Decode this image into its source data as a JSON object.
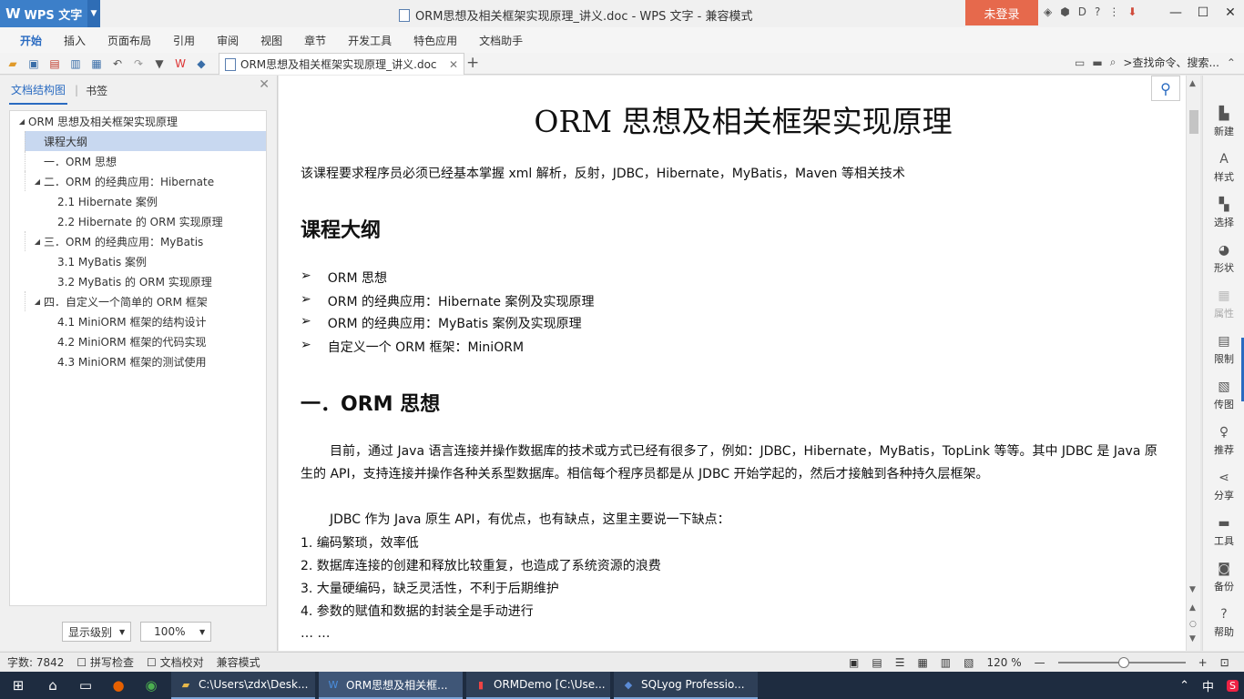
{
  "titlebar": {
    "app_name": "WPS 文字",
    "title": "ORM思想及相关框架实现原理_讲义.doc - WPS 文字 - 兼容模式",
    "login": "未登录"
  },
  "ribbon": {
    "tabs": [
      "开始",
      "插入",
      "页面布局",
      "引用",
      "审阅",
      "视图",
      "章节",
      "开发工具",
      "特色应用",
      "文档助手"
    ]
  },
  "toolbar": {
    "doc_tab": "ORM思想及相关框架实现原理_讲义.doc",
    "search": ">查找命令、搜索..."
  },
  "leftpanel": {
    "tab_outline": "文档结构图",
    "tab_bookmark": "书签",
    "outline": [
      {
        "label": "ORM 思想及相关框架实现原理",
        "level": 1,
        "expandable": true,
        "selected": false
      },
      {
        "label": "课程大纲",
        "level": 2,
        "expandable": false,
        "selected": true
      },
      {
        "label": "一．ORM 思想",
        "level": 2,
        "expandable": false,
        "selected": false
      },
      {
        "label": "二．ORM 的经典应用：Hibernate",
        "level": 2,
        "expandable": true,
        "selected": false
      },
      {
        "label": "2.1 Hibernate 案例",
        "level": 3,
        "expandable": false,
        "selected": false
      },
      {
        "label": "2.2 Hibernate 的 ORM 实现原理",
        "level": 3,
        "expandable": false,
        "selected": false
      },
      {
        "label": "三．ORM 的经典应用：MyBatis",
        "level": 2,
        "expandable": true,
        "selected": false
      },
      {
        "label": "3.1 MyBatis 案例",
        "level": 3,
        "expandable": false,
        "selected": false
      },
      {
        "label": "3.2 MyBatis 的 ORM 实现原理",
        "level": 3,
        "expandable": false,
        "selected": false
      },
      {
        "label": "四．自定义一个简单的 ORM 框架",
        "level": 2,
        "expandable": true,
        "selected": false
      },
      {
        "label": "4.1 MiniORM 框架的结构设计",
        "level": 3,
        "expandable": false,
        "selected": false
      },
      {
        "label": "4.2 MiniORM 框架的代码实现",
        "level": 3,
        "expandable": false,
        "selected": false
      },
      {
        "label": "4.3 MiniORM 框架的测试使用",
        "level": 3,
        "expandable": false,
        "selected": false
      }
    ],
    "level_select": "显示级别",
    "zoom_select": "100%"
  },
  "document": {
    "title": "ORM 思想及相关框架实现原理",
    "intro": "该课程要求程序员必须已经基本掌握 xml 解析，反射，JDBC，Hibernate，MyBatis，Maven 等相关技术",
    "outline_heading": "课程大纲",
    "bullets": [
      "ORM 思想",
      "ORM 的经典应用：Hibernate 案例及实现原理",
      "ORM 的经典应用：MyBatis 案例及实现原理",
      "自定义一个 ORM 框架：MiniORM"
    ],
    "section1_heading": "一．ORM 思想",
    "para1": "目前，通过 Java 语言连接并操作数据库的技术或方式已经有很多了，例如：JDBC，Hibernate，MyBatis，TopLink 等等。其中 JDBC 是 Java 原生的 API，支持连接并操作各种关系型数据库。相信每个程序员都是从 JDBC 开始学起的，然后才接触到各种持久层框架。",
    "para2": "JDBC 作为 Java 原生 API，有优点，也有缺点，这里主要说一下缺点：",
    "list": [
      "1. 编码繁琐，效率低",
      "2. 数据库连接的创建和释放比较重复，也造成了系统资源的浪费",
      "3. 大量硬编码，缺乏灵活性，不利于后期维护",
      "4. 参数的赋值和数据的封装全是手动进行"
    ],
    "ellipsis": "… …"
  },
  "rightbar": {
    "items": [
      {
        "label": "新建",
        "icon": "new-icon",
        "dim": false
      },
      {
        "label": "样式",
        "icon": "style-icon",
        "dim": false
      },
      {
        "label": "选择",
        "icon": "select-icon",
        "dim": false
      },
      {
        "label": "形状",
        "icon": "shape-icon",
        "dim": false
      },
      {
        "label": "属性",
        "icon": "property-icon",
        "dim": true
      },
      {
        "label": "限制",
        "icon": "restrict-icon",
        "dim": false
      },
      {
        "label": "传图",
        "icon": "upload-image-icon",
        "dim": false
      },
      {
        "label": "推荐",
        "icon": "recommend-icon",
        "dim": false
      },
      {
        "label": "分享",
        "icon": "share-icon",
        "dim": false
      },
      {
        "label": "工具",
        "icon": "tools-icon",
        "dim": false
      },
      {
        "label": "备份",
        "icon": "backup-icon",
        "dim": false
      },
      {
        "label": "帮助",
        "icon": "help-icon",
        "dim": false
      }
    ]
  },
  "statusbar": {
    "word_count": "字数: 7842",
    "spell_check": "拼写检查",
    "doc_proof": "文档校对",
    "compat_mode": "兼容模式",
    "zoom": "120 %"
  },
  "taskbar": {
    "tasks": [
      {
        "label": "C:\\Users\\zdx\\Desk...",
        "icon": "folder-icon"
      },
      {
        "label": "ORM思想及相关框...",
        "icon": "wps-icon"
      },
      {
        "label": "ORMDemo [C:\\Use...",
        "icon": "idea-icon"
      },
      {
        "label": "SQLyog Professio...",
        "icon": "sqlyog-icon"
      }
    ],
    "ime": "中"
  },
  "colors": {
    "accent": "#2a6bc1",
    "login": "#e6694c",
    "taskbar": "#1e2c40"
  }
}
